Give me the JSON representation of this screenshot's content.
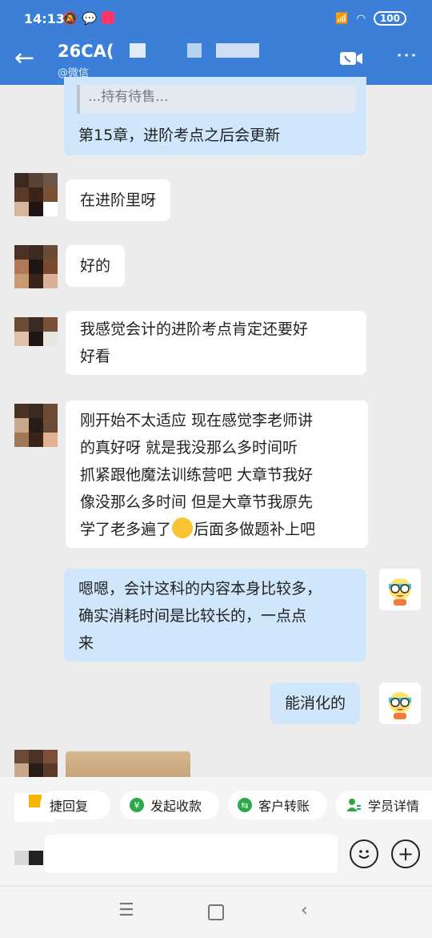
{
  "status_bar": {
    "time": "14:13",
    "battery": "100",
    "left_icons": [
      "bell-off-icon",
      "wechat-icon",
      "app-icon"
    ]
  },
  "header": {
    "title": "26CA(",
    "subtitle": "@微信"
  },
  "quoted_text": "...持有待售...",
  "messages": [
    {
      "from": "me",
      "text": "第15章，进阶考点之后会更新"
    },
    {
      "from": "user",
      "text": "在进阶里呀"
    },
    {
      "from": "user",
      "text": "好的"
    },
    {
      "from": "user",
      "lines": [
        "我感觉会计的进阶考点肯定还要好",
        "好看"
      ]
    },
    {
      "from": "user",
      "lines": [
        "刚开始不太适应 现在感觉李老师讲",
        "的真好呀 就是我没那么多时间听",
        "抓紧跟他魔法训练营吧 大章节我好",
        "像没那么多时间 但是大章节我原先",
        "学了老多遍了",
        "后面多做题补上吧"
      ]
    },
    {
      "from": "me",
      "lines": [
        "嗯嗯，会计这科的内容本身比较多，",
        "确实消耗时间是比较长的，一点点",
        "来"
      ]
    },
    {
      "from": "me",
      "text": "能消化的"
    }
  ],
  "quick_actions": [
    {
      "label": "捷回复"
    },
    {
      "label": "发起收款",
      "icon": "¥"
    },
    {
      "label": "客户转账",
      "icon": "⇆"
    },
    {
      "label": "学员详情",
      "icon": "user"
    }
  ],
  "colors": {
    "header": "#3b7fd9",
    "bubble_out": "#cfe6fb",
    "bubble_in": "#ffffff",
    "action_green": "#2ea84a"
  }
}
